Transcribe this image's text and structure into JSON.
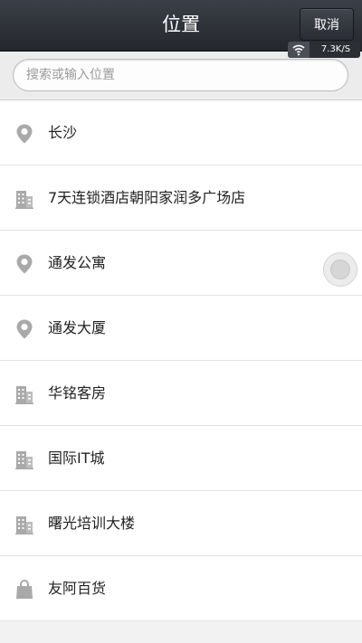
{
  "header": {
    "title": "位置",
    "cancel_label": "取消"
  },
  "status": {
    "net_speed": "7.3K/S",
    "icon": "wifi-icon"
  },
  "search": {
    "placeholder": "搜索或输入位置",
    "value": ""
  },
  "locations": [
    {
      "label": "长沙",
      "icon": "location-pin-icon"
    },
    {
      "label": "7天连锁酒店朝阳家润多广场店",
      "icon": "building-icon"
    },
    {
      "label": "通发公寓",
      "icon": "location-pin-icon"
    },
    {
      "label": "通发大厦",
      "icon": "location-pin-icon"
    },
    {
      "label": "华铭客房",
      "icon": "building-icon"
    },
    {
      "label": "国际IT城",
      "icon": "building-icon"
    },
    {
      "label": "曙光培训大楼",
      "icon": "building-icon"
    },
    {
      "label": "友阿百货",
      "icon": "shopping-bag-icon"
    }
  ],
  "colors": {
    "header_bg": "#2c2f35",
    "icon_gray": "#a9a9a9",
    "divider": "#e2e2e2"
  }
}
